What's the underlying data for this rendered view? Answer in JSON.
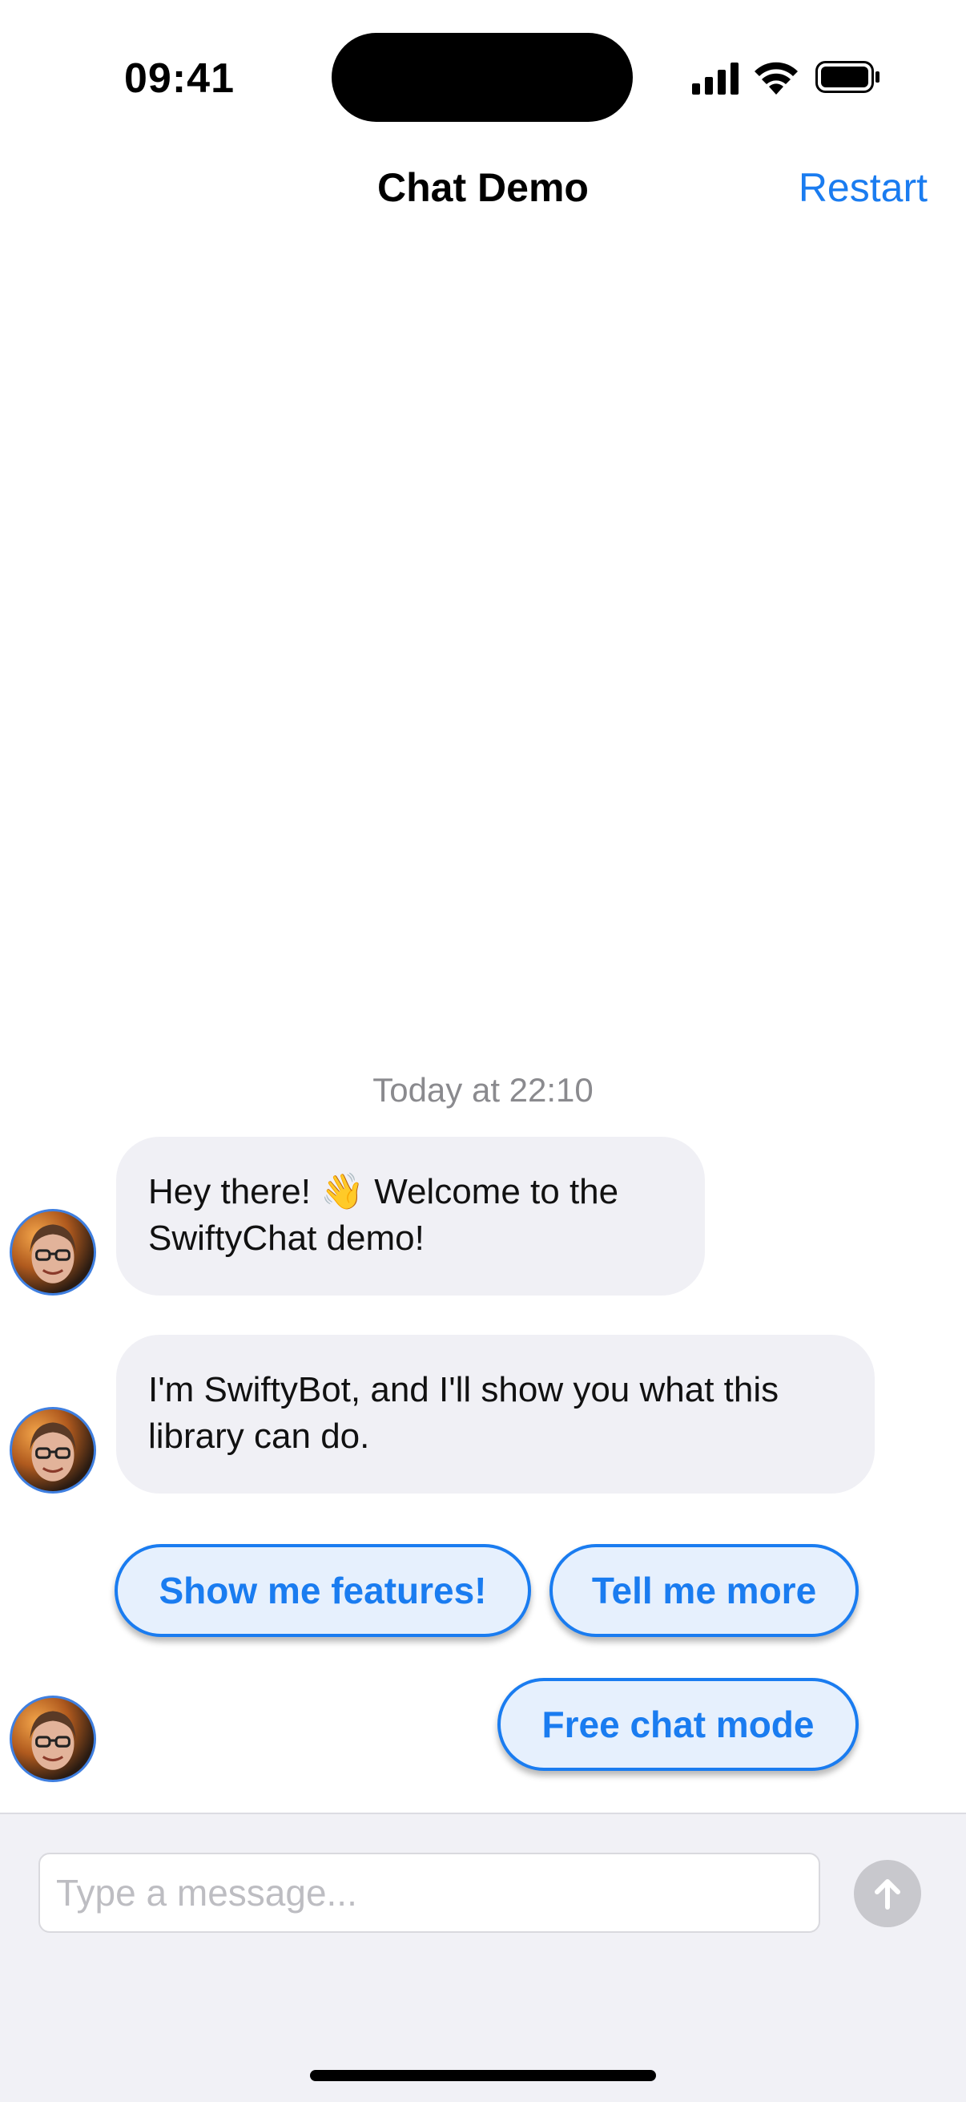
{
  "status_bar": {
    "time": "09:41",
    "icons": [
      "signal-icon",
      "wifi-icon",
      "battery-icon"
    ]
  },
  "nav": {
    "title": "Chat Demo",
    "restart_label": "Restart"
  },
  "chat": {
    "timestamp": "Today at 22:10",
    "messages": [
      {
        "sender": "SwiftyBot",
        "text_line1": "Hey there! 👋 Welcome to the",
        "text_line2": "SwiftyChat demo!"
      },
      {
        "sender": "SwiftyBot",
        "text_line1": "I'm SwiftyBot, and I'll show you what this",
        "text_line2": "library can do."
      }
    ],
    "quick_replies": [
      {
        "label": "Show me features!"
      },
      {
        "label": "Tell me more"
      },
      {
        "label": "Free chat mode"
      }
    ]
  },
  "composer": {
    "placeholder": "Type a message...",
    "value": "",
    "send_icon": "arrow-up-icon"
  },
  "colors": {
    "accent": "#1a7cf0",
    "bubble_bg": "#f0f0f5",
    "quick_reply_bg": "#e6f0fd",
    "input_bar_bg": "#f1f1f6",
    "send_button_disabled": "#c8c8cd"
  }
}
